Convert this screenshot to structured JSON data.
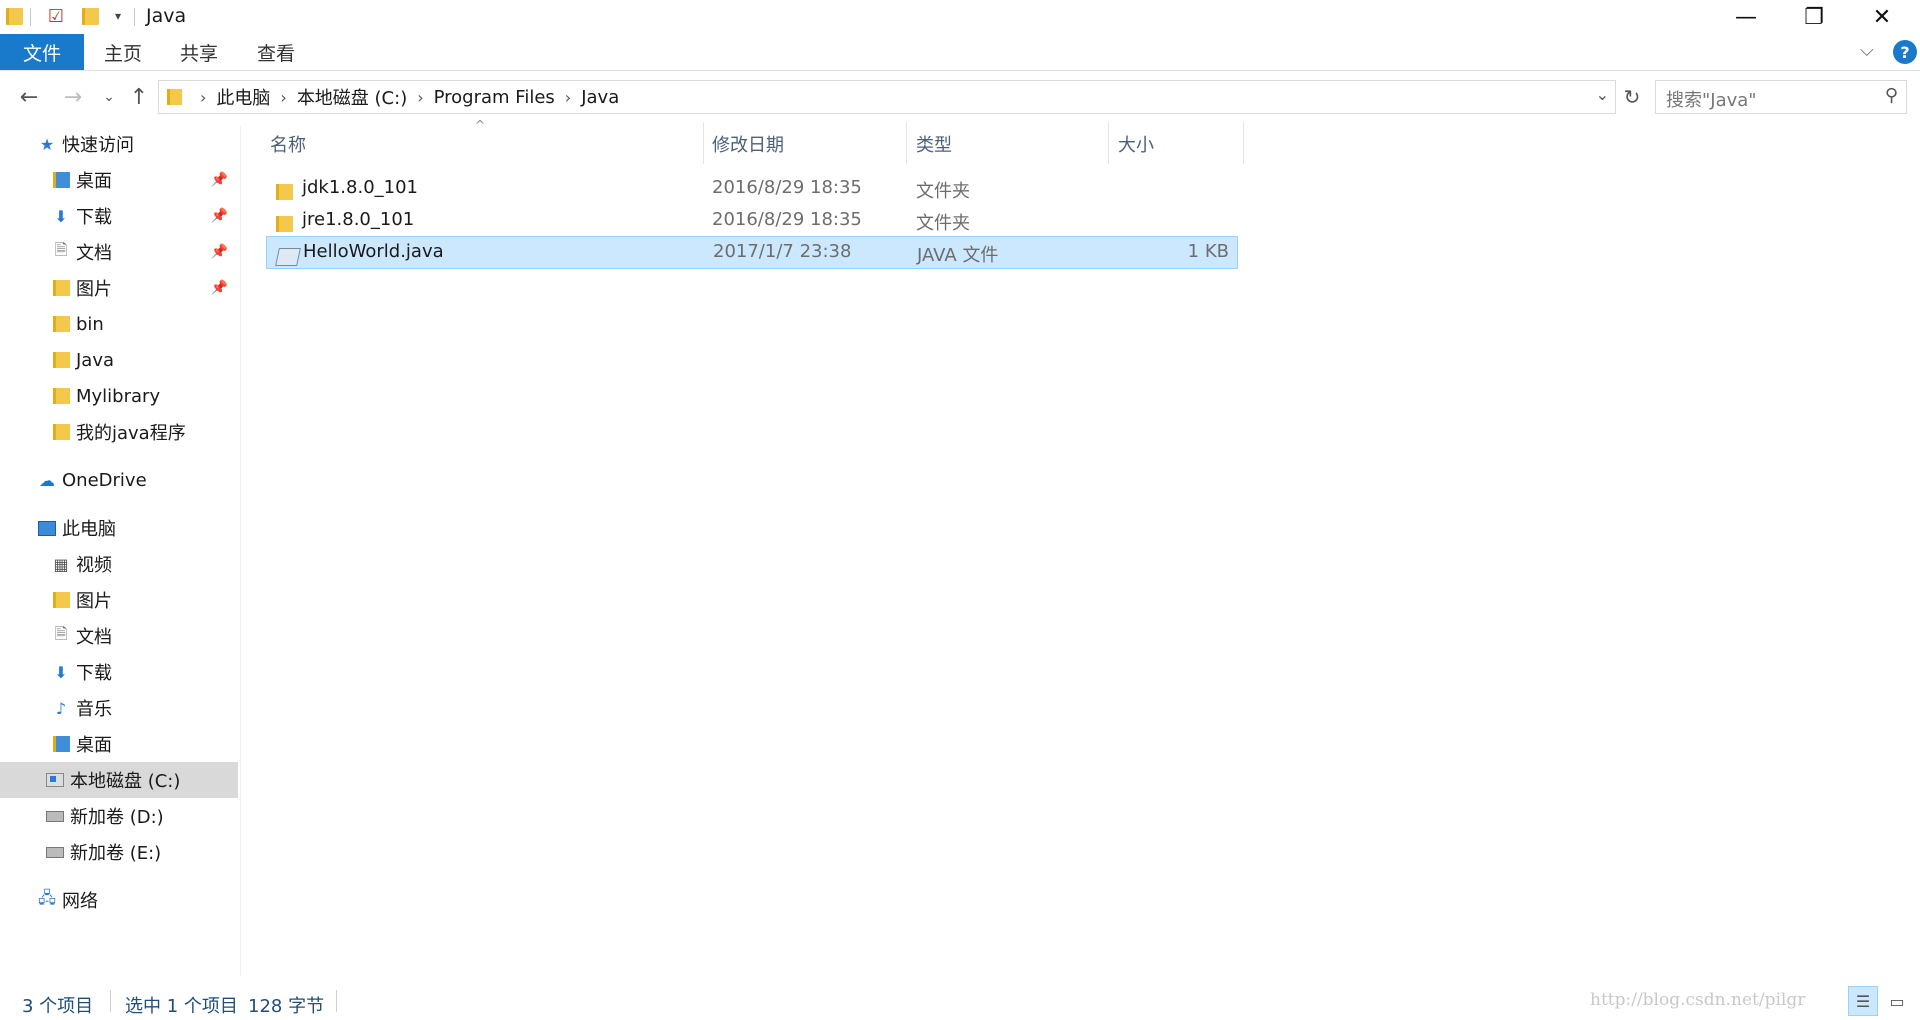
{
  "window": {
    "title": "Java",
    "minimize_glyph": "—",
    "maximize_glyph": "❐",
    "close_glyph": "✕"
  },
  "ribbon": {
    "tabs": [
      "文件",
      "主页",
      "共享",
      "查看"
    ]
  },
  "address": {
    "crumbs": [
      "此电脑",
      "本地磁盘 (C:)",
      "Program Files",
      "Java"
    ],
    "search_placeholder": "搜索\"Java\""
  },
  "nav": {
    "quick_access": "快速访问",
    "quick_items": [
      "桌面",
      "下载",
      "文档",
      "图片",
      "bin",
      "Java",
      "Mylibrary",
      "我的java程序"
    ],
    "onedrive": "OneDrive",
    "this_pc": "此电脑",
    "pc_items": [
      "视频",
      "图片",
      "文档",
      "下载",
      "音乐",
      "桌面",
      "本地磁盘 (C:)",
      "新加卷 (D:)",
      "新加卷 (E:)"
    ],
    "network": "网络"
  },
  "columns": {
    "name": "名称",
    "date": "修改日期",
    "type": "类型",
    "size": "大小"
  },
  "files": [
    {
      "name": "jdk1.8.0_101",
      "date": "2016/8/29 18:35",
      "type": "文件夹",
      "size": ""
    },
    {
      "name": "jre1.8.0_101",
      "date": "2016/8/29 18:35",
      "type": "文件夹",
      "size": ""
    },
    {
      "name": "HelloWorld.java",
      "date": "2017/1/7 23:38",
      "type": "JAVA 文件",
      "size": "1 KB"
    }
  ],
  "status": {
    "item_count": "3 个项目",
    "selection": "选中 1 个项目",
    "selection_size": "128 字节",
    "watermark": "http://blog.csdn.net/pilgr"
  },
  "colors": {
    "accent": "#1979ca",
    "selection_bg": "#cce8ff",
    "selection_border": "#99d1ff",
    "nav_selected": "#d9d9d9",
    "folder": "#f3c84b"
  }
}
